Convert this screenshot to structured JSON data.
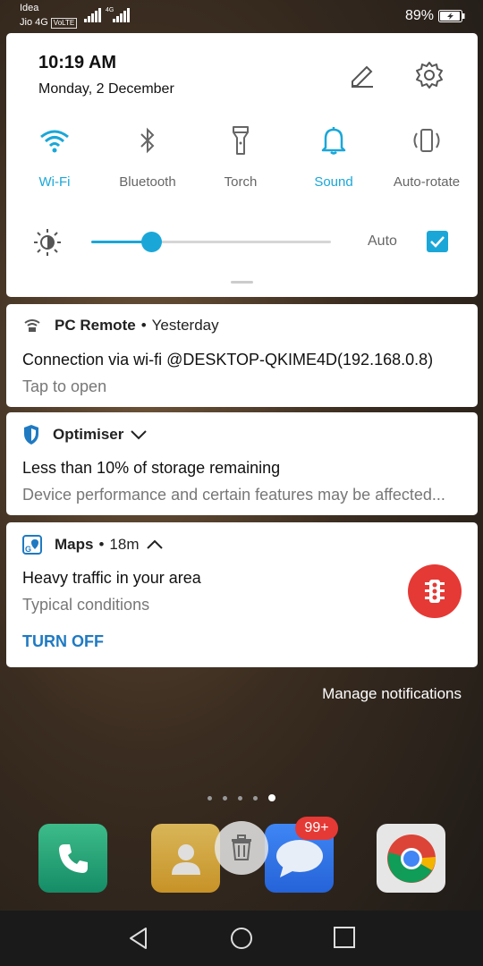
{
  "status_bar": {
    "carrier_line1": "Idea",
    "carrier_line2": "Jio 4G",
    "volte": "VoLTE",
    "network": "4G",
    "battery": "89%"
  },
  "quick_settings": {
    "time": "10:19 AM",
    "date": "Monday, 2 December",
    "tiles": [
      {
        "label": "Wi-Fi",
        "icon": "wifi-icon",
        "active": true
      },
      {
        "label": "Bluetooth",
        "icon": "bluetooth-icon",
        "active": false
      },
      {
        "label": "Torch",
        "icon": "torch-icon",
        "active": false
      },
      {
        "label": "Sound",
        "icon": "bell-icon",
        "active": true
      },
      {
        "label": "Auto-rotate",
        "icon": "rotate-icon",
        "active": false
      }
    ],
    "brightness": {
      "level": 0.25,
      "auto_label": "Auto",
      "auto_checked": true
    }
  },
  "notifications": [
    {
      "app": "PC Remote",
      "time": "Yesterday",
      "title": "Connection via wi-fi @DESKTOP-QKIME4D(192.168.0.8)",
      "text": "Tap to open"
    },
    {
      "app": "Optimiser",
      "title": "Less than 10% of storage remaining",
      "text": "Device performance and certain features may be affected..."
    },
    {
      "app": "Maps",
      "time": "18m",
      "title": "Heavy traffic in your area",
      "text": "Typical conditions",
      "action": "TURN OFF"
    }
  ],
  "manage_notifications": "Manage notifications",
  "dock": {
    "messages_badge": "99+"
  },
  "colors": {
    "accent": "#1aa7d8",
    "action": "#1f7ac2",
    "traffic": "#e53935"
  }
}
